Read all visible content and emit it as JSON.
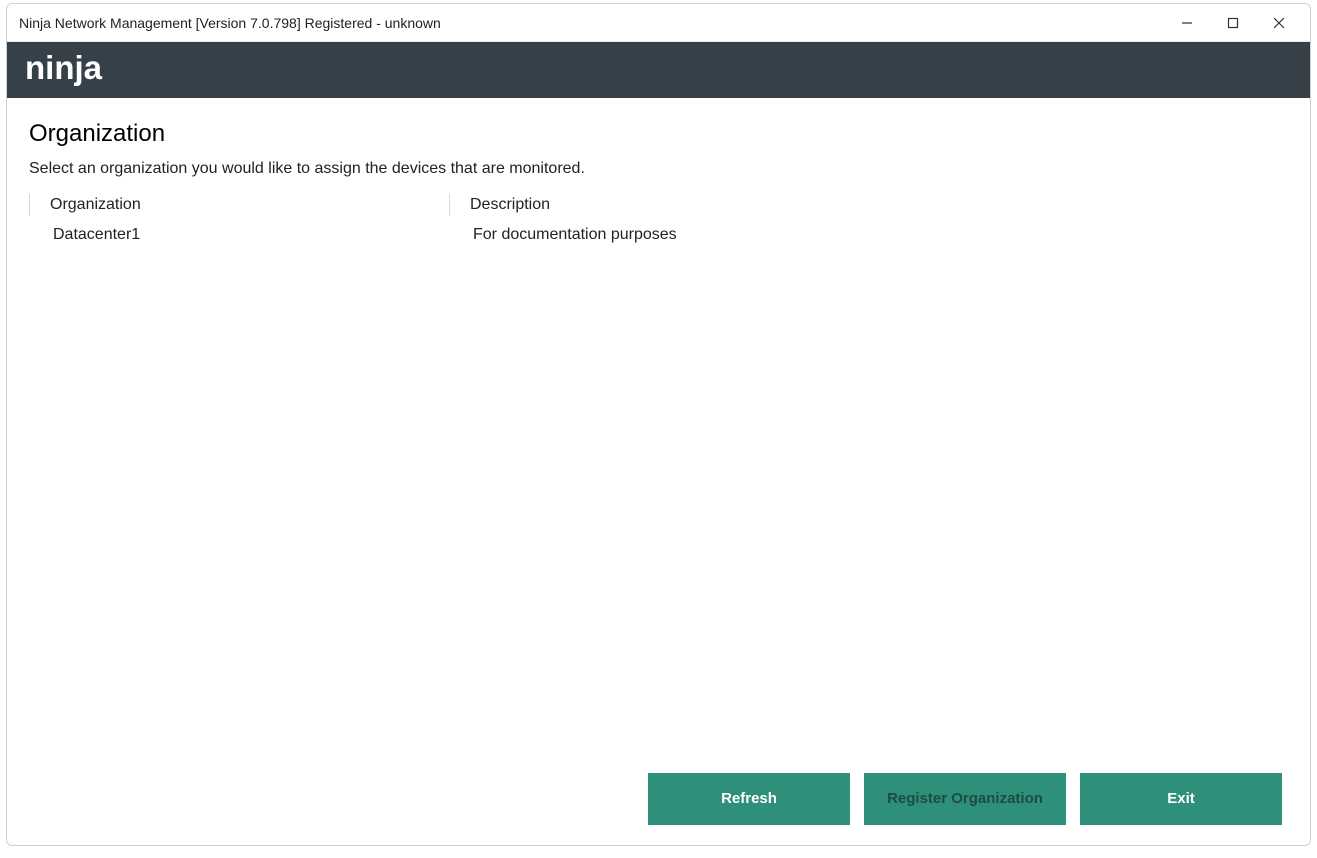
{
  "window": {
    "title": "Ninja Network Management [Version 7.0.798] Registered - unknown"
  },
  "brand": {
    "name": "ninja"
  },
  "page": {
    "title": "Organization",
    "subtitle": "Select an organization you would like to assign the devices that are monitored."
  },
  "table": {
    "headers": {
      "organization": "Organization",
      "description": "Description"
    },
    "rows": [
      {
        "organization": "Datacenter1",
        "description": "For documentation purposes"
      }
    ]
  },
  "footer": {
    "refresh": "Refresh",
    "register": "Register\nOrganization",
    "exit": "Exit"
  }
}
